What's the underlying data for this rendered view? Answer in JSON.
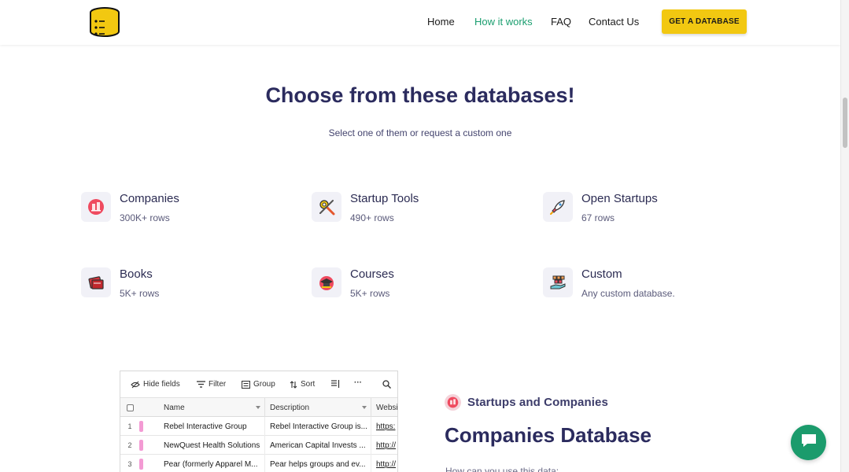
{
  "header": {
    "logo_icon": "database-icon",
    "nav": [
      {
        "label": "Home",
        "active": false
      },
      {
        "label": "How it works",
        "active": true
      },
      {
        "label": "FAQ",
        "active": false
      },
      {
        "label": "Contact Us",
        "active": false
      }
    ],
    "cta_label": "GET A DATABASE",
    "accent_color": "#f2c811",
    "active_color": "#1a9e6f"
  },
  "hero": {
    "title": "Choose from these databases!",
    "subtitle": "Select one of them or request a custom one"
  },
  "databases": [
    {
      "title": "Companies",
      "rows": "300K+ rows",
      "icon": "office-building-icon"
    },
    {
      "title": "Startup Tools",
      "rows": "490+ rows",
      "icon": "tools-icon"
    },
    {
      "title": "Open Startups",
      "rows": "67 rows",
      "icon": "rocket-icon"
    },
    {
      "title": "Books",
      "rows": "5K+ rows",
      "icon": "books-icon"
    },
    {
      "title": "Courses",
      "rows": "5K+ rows",
      "icon": "graduation-cap-icon"
    },
    {
      "title": "Custom",
      "rows": "Any custom database.",
      "icon": "hand-boxes-icon"
    }
  ],
  "grid": {
    "toolbar": {
      "hide_fields": "Hide fields",
      "filter": "Filter",
      "group": "Group",
      "sort": "Sort",
      "more": "···"
    },
    "columns": [
      "Name",
      "Description",
      "Websi"
    ],
    "rows": [
      {
        "num": "1",
        "name": "Rebel Interactive Group",
        "description": "Rebel Interactive Group is...",
        "website": "https:"
      },
      {
        "num": "2",
        "name": "NewQuest Health Solutions",
        "description": "American Capital Invests ...",
        "website": "http://"
      },
      {
        "num": "3",
        "name": "Pear (formerly Apparel M...",
        "description": "Pear helps groups and ev...",
        "website": "http://"
      }
    ]
  },
  "section": {
    "tag": "Startups and Companies",
    "title": "Companies Database",
    "text": "How can you use this data:"
  },
  "chat": {
    "icon": "chat-bubble-icon",
    "color": "#1b9b6c"
  }
}
